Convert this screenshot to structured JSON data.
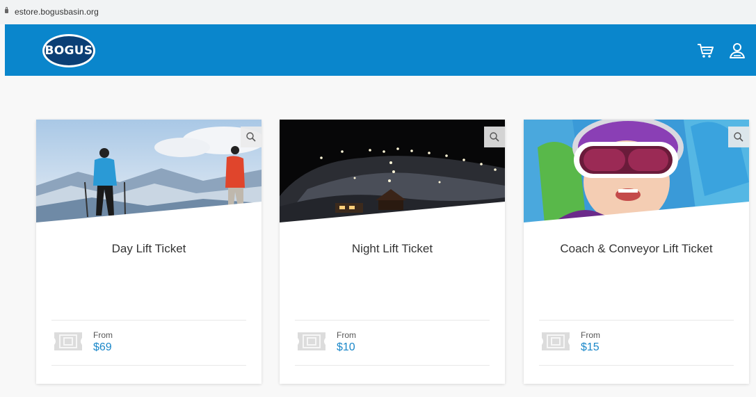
{
  "browser": {
    "url": "estore.bogusbasin.org"
  },
  "header": {
    "logo_text": "BOGUS",
    "brand_color": "#0a86cc",
    "logo_color": "#0b3f75",
    "icons": [
      "cart-icon",
      "user-icon"
    ]
  },
  "products": [
    {
      "title": "Day Lift Ticket",
      "from_label": "From",
      "price": "$69",
      "image": "skiers-on-mountain-photo"
    },
    {
      "title": "Night Lift Ticket",
      "from_label": "From",
      "price": "$10",
      "image": "night-ski-slope-photo"
    },
    {
      "title": "Coach & Conveyor Lift Ticket",
      "from_label": "From",
      "price": "$15",
      "image": "child-with-goggles-photo"
    }
  ],
  "price_color": "#1a87c9"
}
